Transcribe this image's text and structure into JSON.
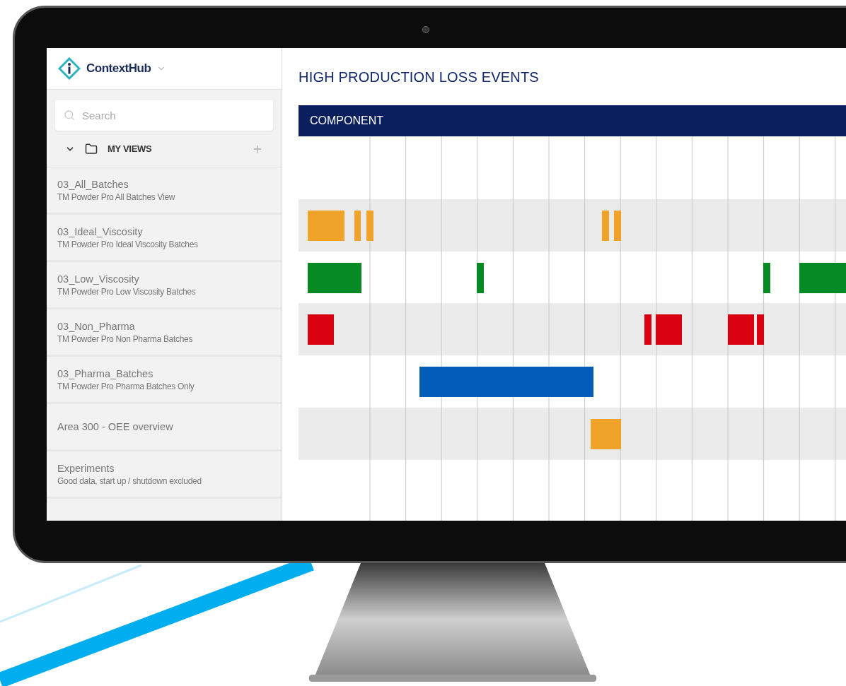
{
  "app": {
    "name": "ContextHub"
  },
  "search": {
    "placeholder": "Search"
  },
  "views": {
    "label": "MY VIEWS",
    "expanded": true
  },
  "view_items": [
    {
      "title": "03_All_Batches",
      "subtitle": "TM Powder Pro All Batches View"
    },
    {
      "title": "03_Ideal_Viscosity",
      "subtitle": "TM Powder Pro Ideal Viscosity Batches"
    },
    {
      "title": "03_Low_Viscosity",
      "subtitle": "TM Powder Pro Low Viscosity Batches"
    },
    {
      "title": "03_Non_Pharma",
      "subtitle": "TM Powder Pro Non Pharma Batches"
    },
    {
      "title": "03_Pharma_Batches",
      "subtitle": "TM Powder Pro Pharma Batches Only"
    },
    {
      "title": "Area 300 - OEE overview"
    },
    {
      "title": "Experiments",
      "subtitle": "Good data, start up / shutdown excluded"
    }
  ],
  "page": {
    "title": "HIGH PRODUCTION LOSS EVENTS",
    "header": "COMPONENT"
  }
}
